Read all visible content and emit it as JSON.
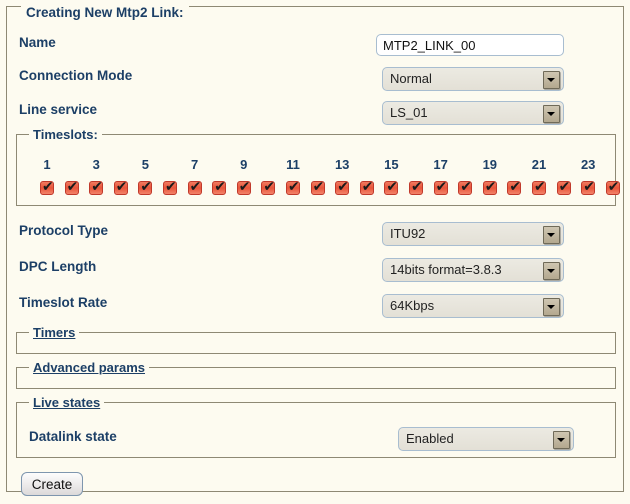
{
  "form": {
    "legend": "Creating New Mtp2 Link:",
    "fields": [
      {
        "label": "Name",
        "type": "text",
        "value": "MTP2_LINK_00"
      },
      {
        "label": "Connection Mode",
        "type": "select",
        "value": "Normal"
      },
      {
        "label": "Line service",
        "type": "select",
        "value": "LS_01"
      }
    ],
    "lower_fields": [
      {
        "label": "Protocol Type",
        "type": "select",
        "value": "ITU92"
      },
      {
        "label": "DPC Length",
        "type": "select",
        "value": "14bits format=3.8.3"
      },
      {
        "label": "Timeslot Rate",
        "type": "select",
        "value": "64Kbps"
      }
    ],
    "submit_label": "Create"
  },
  "timeslots": {
    "legend": "Timeslots:",
    "labels": [
      "1",
      "3",
      "5",
      "7",
      "9",
      "11",
      "13",
      "15",
      "17",
      "19",
      "21",
      "23"
    ],
    "count": 24,
    "checked": [
      true,
      true,
      true,
      true,
      true,
      true,
      true,
      true,
      true,
      true,
      true,
      true,
      true,
      true,
      true,
      true,
      true,
      true,
      true,
      true,
      true,
      true,
      true,
      true
    ],
    "check_glyph": "✔"
  },
  "sections": [
    {
      "legend": "Timers"
    },
    {
      "legend": "Advanced params"
    }
  ],
  "live_states": {
    "legend": "Live states",
    "field": {
      "label": "Datalink state",
      "type": "select",
      "value": "Enabled"
    }
  },
  "icons": {
    "dropdown_arrow": "chevron-down-icon"
  },
  "colors": {
    "background": "#fdfbf0",
    "label_text": "#1c3f66",
    "frame_border": "#8e8974",
    "checkbox_fill": "#e8553a",
    "input_border": "#a8bdd0"
  }
}
